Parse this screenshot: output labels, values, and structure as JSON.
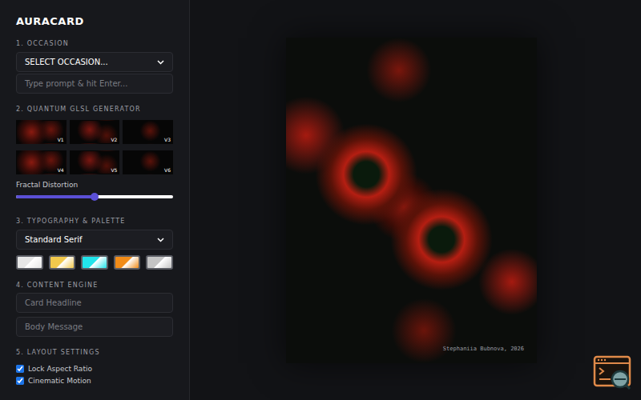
{
  "app": {
    "title": "AURACARD"
  },
  "sections": {
    "occasion": "1. OCCASION",
    "generator": "2. QUANTUM GLSL GENERATOR",
    "typography": "3. TYPOGRAPHY & PALETTE",
    "content": "4. CONTENT ENGINE",
    "layout": "5. LAYOUT SETTINGS"
  },
  "occasion_select": {
    "value": "SELECT OCCASION..."
  },
  "prompt_input": {
    "placeholder": "Type prompt & hit Enter..."
  },
  "variants": [
    {
      "label": "V1",
      "selected": false
    },
    {
      "label": "V2",
      "selected": false
    },
    {
      "label": "V3",
      "selected": false
    },
    {
      "label": "V4",
      "selected": false
    },
    {
      "label": "V5",
      "selected": false
    },
    {
      "label": "V6",
      "selected": false
    }
  ],
  "distortion": {
    "label": "Fractal Distortion",
    "level": 0.5
  },
  "font_select": {
    "value": "Standard Serif"
  },
  "palette": [
    {
      "color": "#e6e6e6",
      "selected": false
    },
    {
      "color": "#f2c94c",
      "selected": false
    },
    {
      "color": "#22e4ea",
      "selected": false
    },
    {
      "color": "#f28c18",
      "selected": false
    },
    {
      "color": "#c4c4c4",
      "selected": false
    }
  ],
  "headline_input": {
    "placeholder": "Card Headline"
  },
  "body_input": {
    "placeholder": "Body Message"
  },
  "settings": [
    {
      "label": "Lock Aspect Ratio",
      "checked": true
    },
    {
      "label": "Cinematic Motion",
      "checked": true
    }
  ],
  "card": {
    "signature": "Stephaniia Bubnova, 2026"
  }
}
